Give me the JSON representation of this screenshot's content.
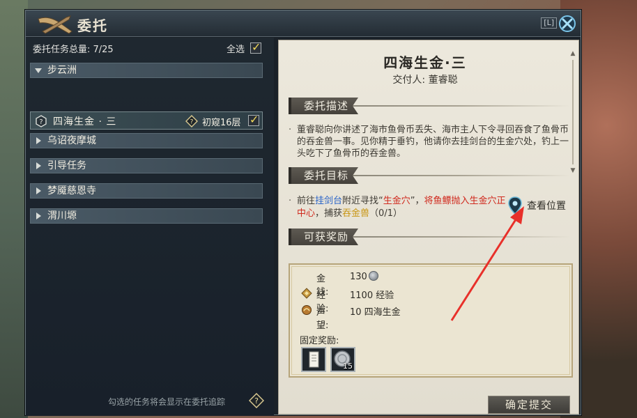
{
  "window": {
    "title": "委托",
    "hotkey": "[L]"
  },
  "list": {
    "summary": "委托任务总量: 7/25",
    "select_all": "全选",
    "categories": [
      {
        "label": "步云洲",
        "expanded": true
      },
      {
        "label": "乌诏夜摩城",
        "expanded": false
      },
      {
        "label": "引导任务",
        "expanded": false
      },
      {
        "label": "梦魇慈恩寺",
        "expanded": false
      },
      {
        "label": "渭川塬",
        "expanded": false
      }
    ],
    "task": {
      "name": "四海生金 · 三",
      "level": "初窥16层",
      "checked": true
    },
    "footer_note": "勾选的任务将会显示在委托追踪"
  },
  "detail": {
    "title": "四海生金·三",
    "giver": "交付人: 董睿聪",
    "sections": {
      "description": "委托描述",
      "goal": "委托目标",
      "rewards": "可获奖励"
    },
    "description_text": "董睿聪向你讲述了海市鱼骨币丢失、海市主人下令寻回吞食了鱼骨币的吞金兽一事。见你精于垂钓，他请你去挂剑台的生金穴处，钓上一头吃下了鱼骨币的吞金兽。",
    "goal": {
      "p1": "前往",
      "place": "挂剑台",
      "p2": "附近寻找“",
      "spot": "生金穴",
      "p3": "”，",
      "action": "将鱼鳔抛入生金穴正中心",
      "p4": "，捕获",
      "target": "吞金兽",
      "progress": "（0/1）"
    },
    "view_location": "查看位置",
    "rewards": {
      "money_label": "金钱:",
      "money_value": "130",
      "exp_label": "经验:",
      "exp_value": "1100 经验",
      "rep_label": "声望:",
      "rep_value": "10 四海生金",
      "fixed_label": "固定奖励:",
      "fixed_items": [
        {
          "icon": "scroll-item-icon",
          "count": ""
        },
        {
          "icon": "silver-coin-item-icon",
          "count": "15"
        }
      ]
    },
    "submit_button": "确定提交"
  },
  "colors": {
    "highlight_blue": "#2a64c8",
    "highlight_red": "#d0281c",
    "highlight_yellow": "#c89614",
    "annotation_arrow": "#e8302a"
  }
}
